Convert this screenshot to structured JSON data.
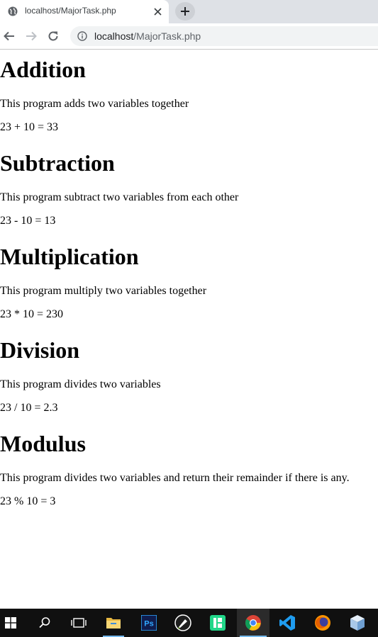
{
  "browser": {
    "tab_title": "localhost/MajorTask.php",
    "url_host": "localhost",
    "url_path": "/MajorTask.php"
  },
  "sections": [
    {
      "heading": "Addition",
      "description": "This program adds two variables together",
      "result": "23 + 10 = 33"
    },
    {
      "heading": "Subtraction",
      "description": "This program subtract two variables from each other",
      "result": "23 - 10 = 13"
    },
    {
      "heading": "Multiplication",
      "description": "This program multiply two variables together",
      "result": "23 * 10 = 230"
    },
    {
      "heading": "Division",
      "description": "This program divides two variables",
      "result": "23 / 10 = 2.3"
    },
    {
      "heading": "Modulus",
      "description": "This program divides two variables and return their remainder if there is any.",
      "result": "23 % 10 = 3"
    }
  ],
  "taskbar": {
    "items": [
      "windows-start-icon",
      "search-icon",
      "task-view-icon",
      "file-explorer-icon",
      "photoshop-icon",
      "inkscape-icon",
      "jetbrains-icon",
      "chrome-icon",
      "vscode-icon",
      "firefox-icon",
      "virtualbox-icon"
    ],
    "photoshop_label": "Ps"
  }
}
